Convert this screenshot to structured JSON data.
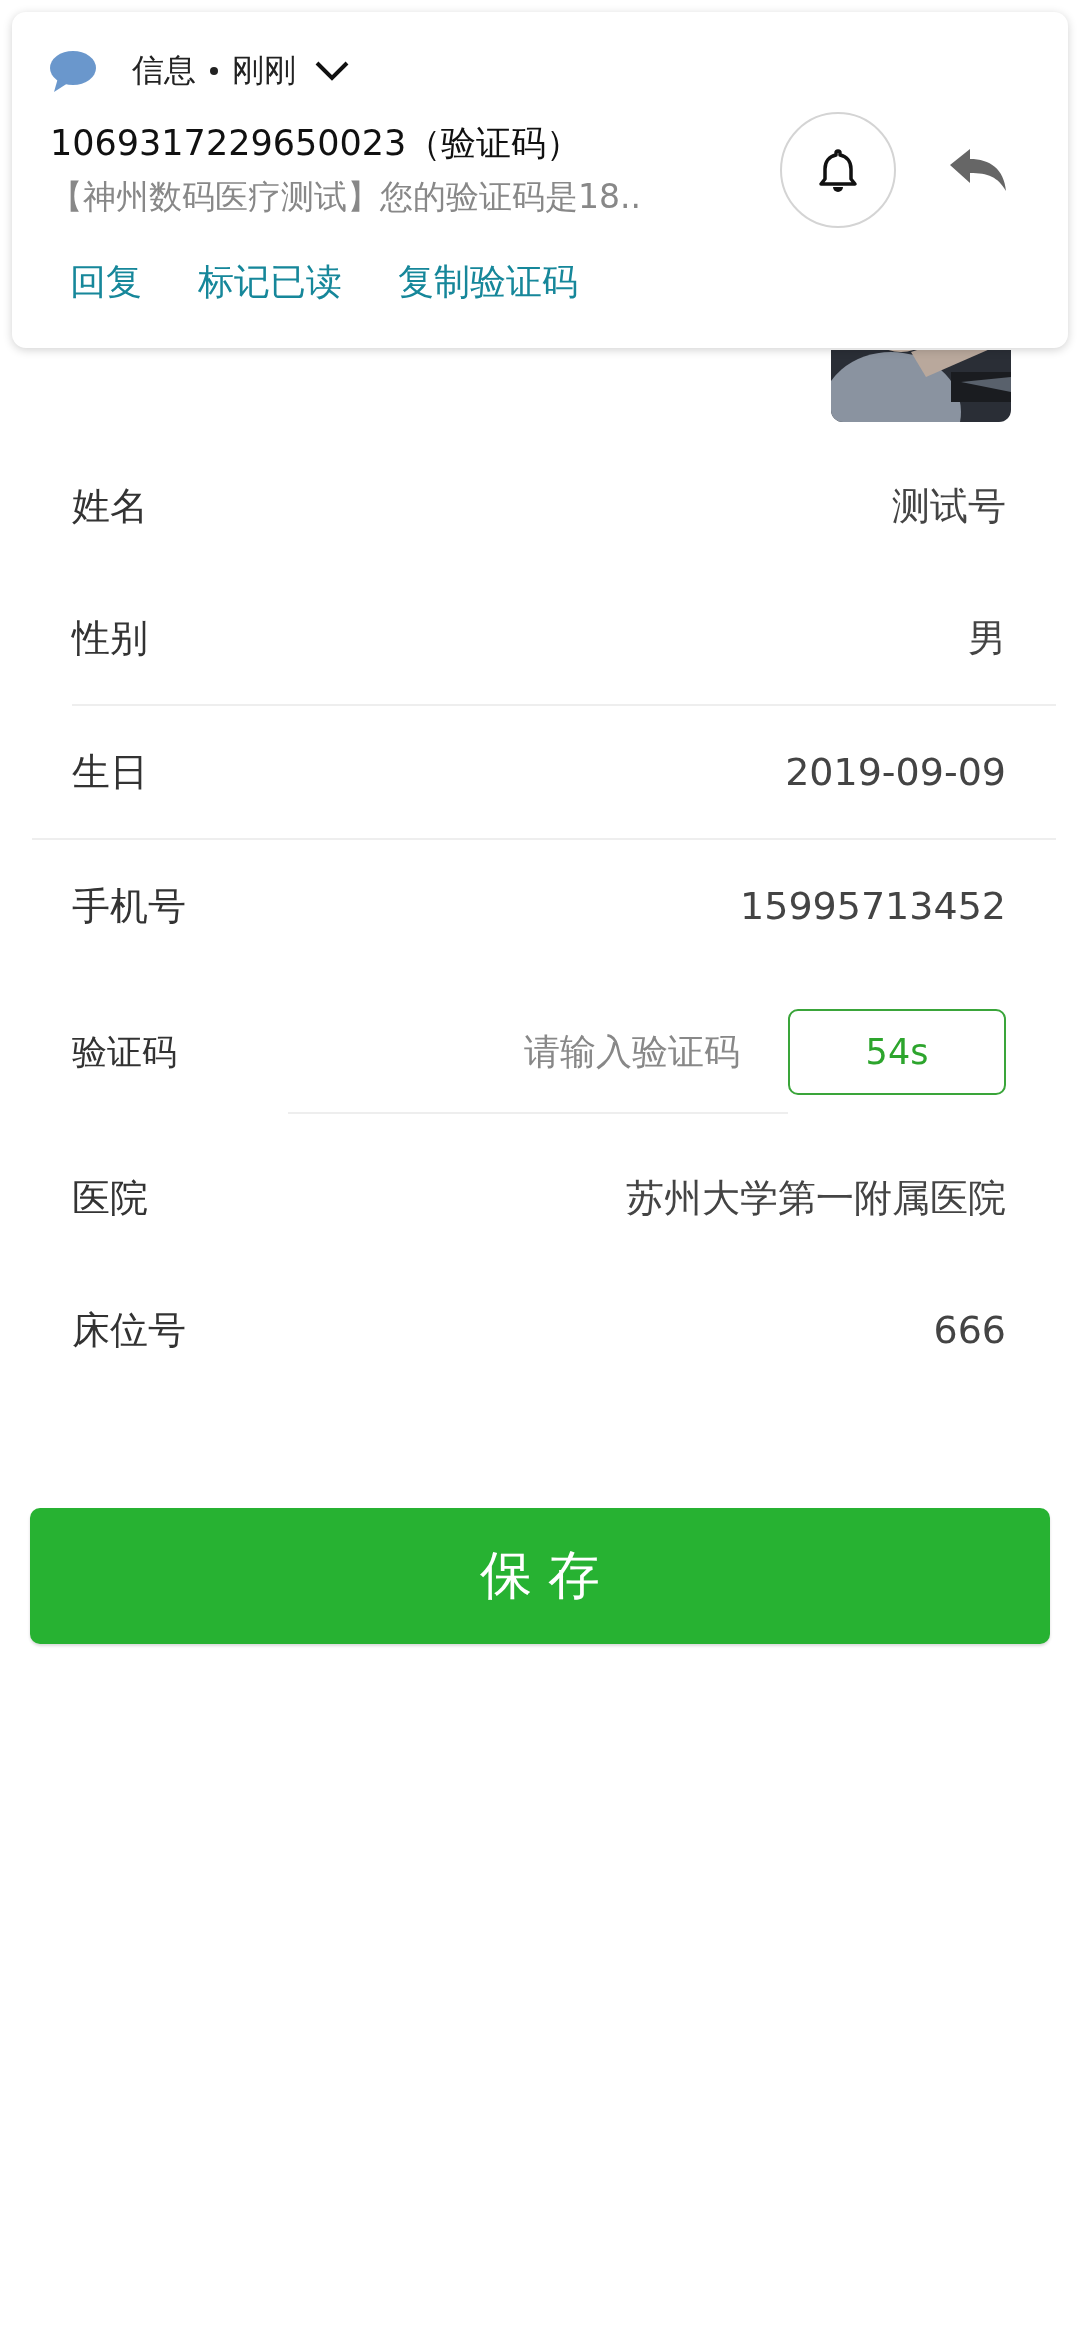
{
  "notification": {
    "app": "信息",
    "time": "刚刚",
    "sender": "1069317229650023（验证码）",
    "preview": "【神州数码医疗测试】您的验证码是18..",
    "actions": [
      "回复",
      "标记已读",
      "复制验证码"
    ]
  },
  "fields": [
    {
      "kind": "text",
      "label": "姓名",
      "value": "测试号"
    },
    {
      "kind": "text",
      "label": "性别",
      "value": "男"
    },
    {
      "kind": "divider",
      "full": false
    },
    {
      "kind": "text",
      "label": "生日",
      "value": "2019-09-09"
    },
    {
      "kind": "divider",
      "full": true
    },
    {
      "kind": "text",
      "label": "手机号",
      "value": "15995713452"
    },
    {
      "kind": "code",
      "label": "验证码",
      "placeholder": "请输入验证码",
      "button": "54s"
    },
    {
      "kind": "text",
      "label": "医院",
      "value": "苏州大学第一附属医院"
    },
    {
      "kind": "text",
      "label": "床位号",
      "value": "666"
    }
  ],
  "save_button": "保 存"
}
